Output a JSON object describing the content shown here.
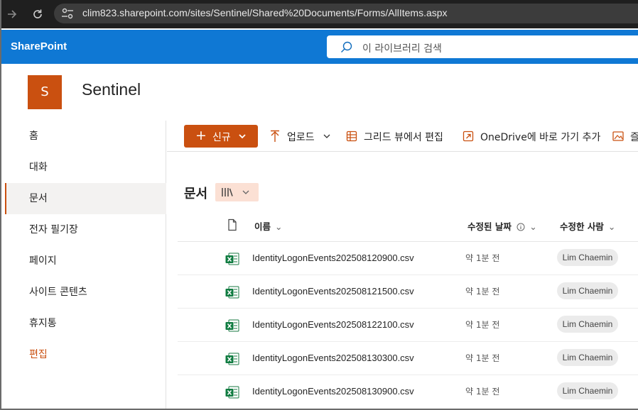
{
  "browser": {
    "url": "clim823.sharepoint.com/sites/Sentinel/Shared%20Documents/Forms/AllItems.aspx",
    "forward_icon": "arrow-right-icon",
    "reload_icon": "reload-icon",
    "site_info_icon": "tune-icon"
  },
  "suite": {
    "brand": "SharePoint",
    "search_placeholder": "이 라이브러리 검색",
    "color": "#0f78d4"
  },
  "site": {
    "logo_letter": "S",
    "logo_color": "#ca5010",
    "title": "Sentinel"
  },
  "nav": {
    "items": [
      {
        "label": "홈"
      },
      {
        "label": "대화"
      },
      {
        "label": "문서",
        "selected": true
      },
      {
        "label": "전자 필기장"
      },
      {
        "label": "페이지"
      },
      {
        "label": "사이트 콘텐츠"
      },
      {
        "label": "휴지통"
      },
      {
        "label": "편집"
      }
    ]
  },
  "commands": {
    "new_label": "신규",
    "upload_label": "업로드",
    "grid_edit_label": "그리드 뷰에서 편집",
    "onedrive_label": "OneDrive에 바로 가기 추가",
    "overflow_label": "즐",
    "accent": "#ca5010"
  },
  "library": {
    "title": "문서",
    "columns": {
      "name": "이름",
      "modified": "수정된 날짜",
      "modified_by": "수정한 사람"
    },
    "files": [
      {
        "name": "IdentityLogonEvents202508120900.csv",
        "modified": "약 1분 전",
        "by": "Lim Chaemin"
      },
      {
        "name": "IdentityLogonEvents202508121500.csv",
        "modified": "약 1분 전",
        "by": "Lim Chaemin"
      },
      {
        "name": "IdentityLogonEvents202508122100.csv",
        "modified": "약 1분 전",
        "by": "Lim Chaemin"
      },
      {
        "name": "IdentityLogonEvents202508130300.csv",
        "modified": "약 1분 전",
        "by": "Lim Chaemin"
      },
      {
        "name": "IdentityLogonEvents202508130900.csv",
        "modified": "약 1분 전",
        "by": "Lim Chaemin"
      }
    ]
  }
}
